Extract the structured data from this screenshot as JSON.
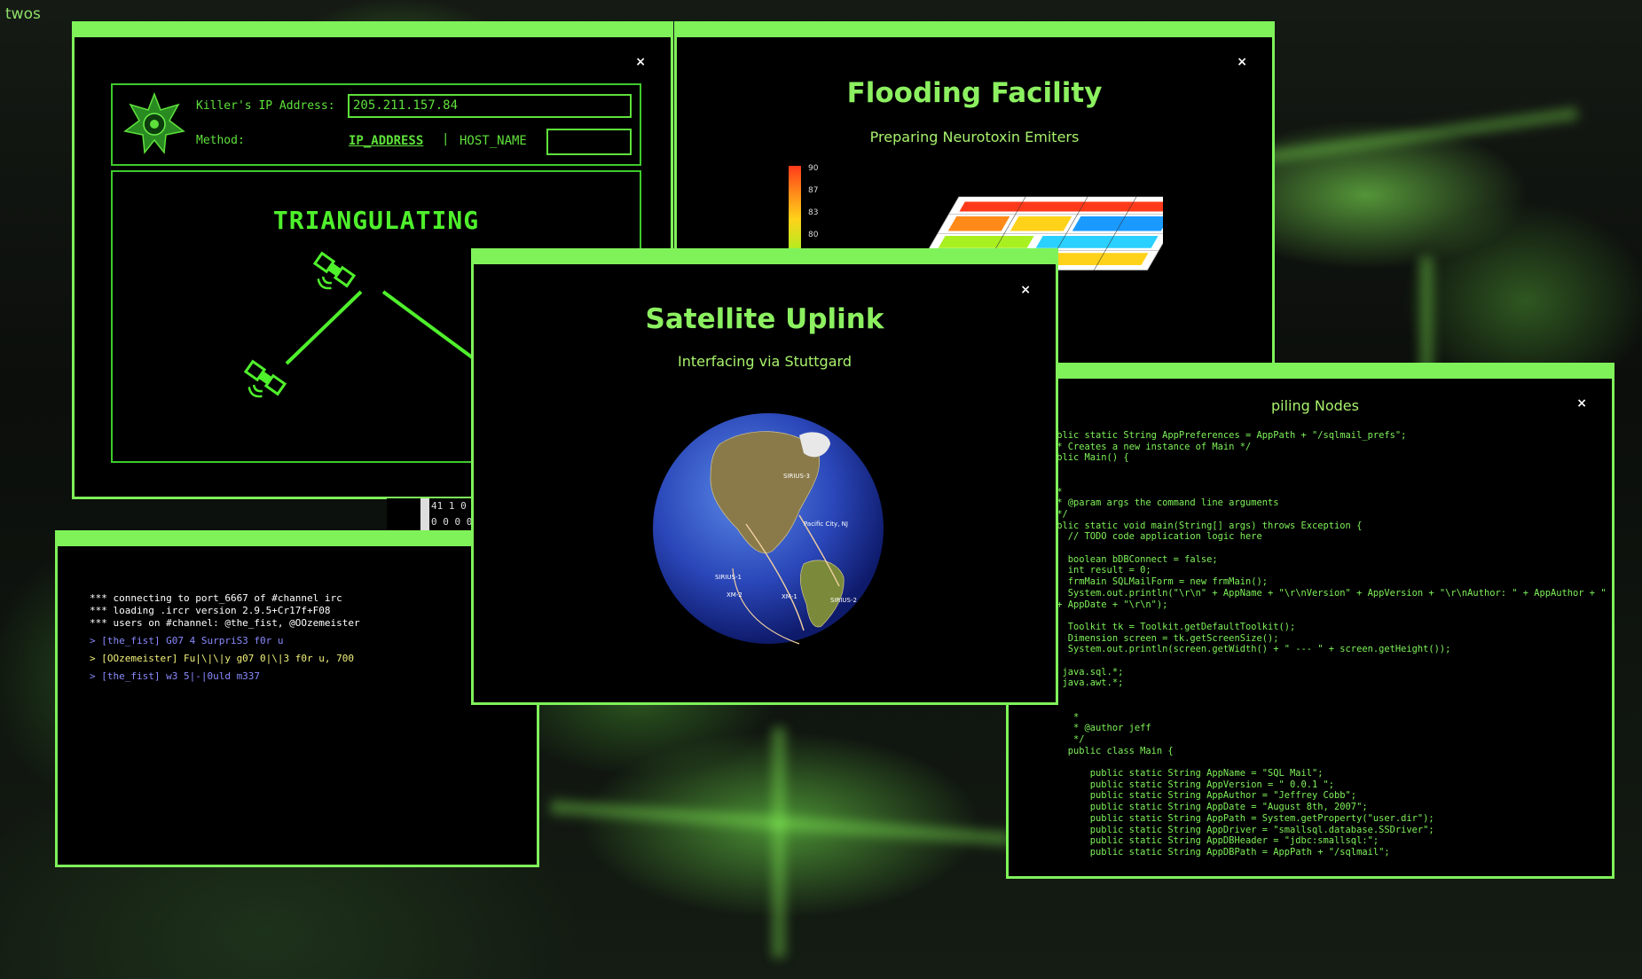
{
  "corner_label": "twos",
  "tracker": {
    "ip_label": "Killer's IP Address:",
    "ip_value": "205.211.157.84",
    "method_label": "Method:",
    "method_option_ip": "IP_ADDRESS",
    "method_separator": "|",
    "method_option_host": "HOST_NAME",
    "host_value": "",
    "status": "TRIANGULATING",
    "close": "×"
  },
  "flooding": {
    "title": "Flooding Facility",
    "subtitle": "Preparing Neurotoxin Emiters",
    "scale": [
      "90",
      "87",
      "83",
      "80"
    ],
    "close": "×"
  },
  "satellite": {
    "title": "Satellite Uplink",
    "subtitle": "Interfacing via Stuttgard",
    "globe_labels": [
      "SIRIUS-3",
      "Pacific City, NJ",
      "SIRIUS-1",
      "XM-2",
      "XM-1",
      "SIRIUS-2"
    ],
    "close": "×"
  },
  "compiler": {
    "title_visible": "piling Nodes",
    "close": "×",
    "lines": [
      "ublic static String AppPreferences = AppPath + \"/sqlmail_prefs\";",
      "** Creates a new instance of Main */",
      "ublic Main() {",
      "",
      "",
      "**",
      " * @param args the command line arguments",
      " */",
      "ublic static void main(String[] args) throws Exception {",
      "   // TODO code application logic here",
      "",
      "   boolean bDBConnect = false;",
      "   int result = 0;",
      "   frmMain SQLMailForm = new frmMain();",
      "   System.out.println(\"\\r\\n\" + AppName + \"\\r\\nVersion\" + AppVersion + \"\\r\\nAuthor: \" + AppAuthor + \"",
      " + AppDate + \"\\r\\n\");",
      "",
      "   Toolkit tk = Toolkit.getDefaultToolkit();",
      "   Dimension screen = tk.getScreenSize();",
      "   System.out.println(screen.getWidth() + \" --- \" + screen.getHeight());",
      "",
      "t java.sql.*;",
      "t java.awt.*;",
      "",
      "",
      "    *",
      "    * @author jeff",
      "    */",
      "   public class Main {",
      "",
      "       public static String AppName = \"SQL Mail\";",
      "       public static String AppVersion = \" 0.0.1 \";",
      "       public static String AppAuthor = \"Jeffrey Cobb\";",
      "       public static String AppDate = \"August 8th, 2007\";",
      "       public static String AppPath = System.getProperty(\"user.dir\");",
      "       public static String AppDriver = \"smallsql.database.SSDriver\";",
      "       public static String AppDBHeader = \"jdbc:smallsql:\";",
      "       public static String AppDBPath = AppPath + \"/sqlmail\";"
    ]
  },
  "irc": {
    "lines": [
      {
        "text": "*** connecting to port_6667 of #channel irc",
        "color": "#ffffff"
      },
      {
        "text": "*** loading .ircr version 2.9.5+Cr17f+F08",
        "color": "#ffffff"
      },
      {
        "text": "*** users on #channel: @the_fist, @OOzemeister",
        "color": "#ffffff"
      },
      {
        "text": "> [the_fist] G07 4 SurpriS3 f0r u",
        "color": "#8a8aff"
      },
      {
        "text": "> [OOzemeister] Fu|\\|\\|y g07 0|\\|3 f0r u, 700",
        "color": "#f2f27a"
      },
      {
        "text": "> [the_fist] w3 5|-|0uld m337",
        "color": "#8a8aff"
      }
    ]
  },
  "binary_strip": {
    "row1": "41 1 0",
    "row2": "0 0 0 0"
  }
}
